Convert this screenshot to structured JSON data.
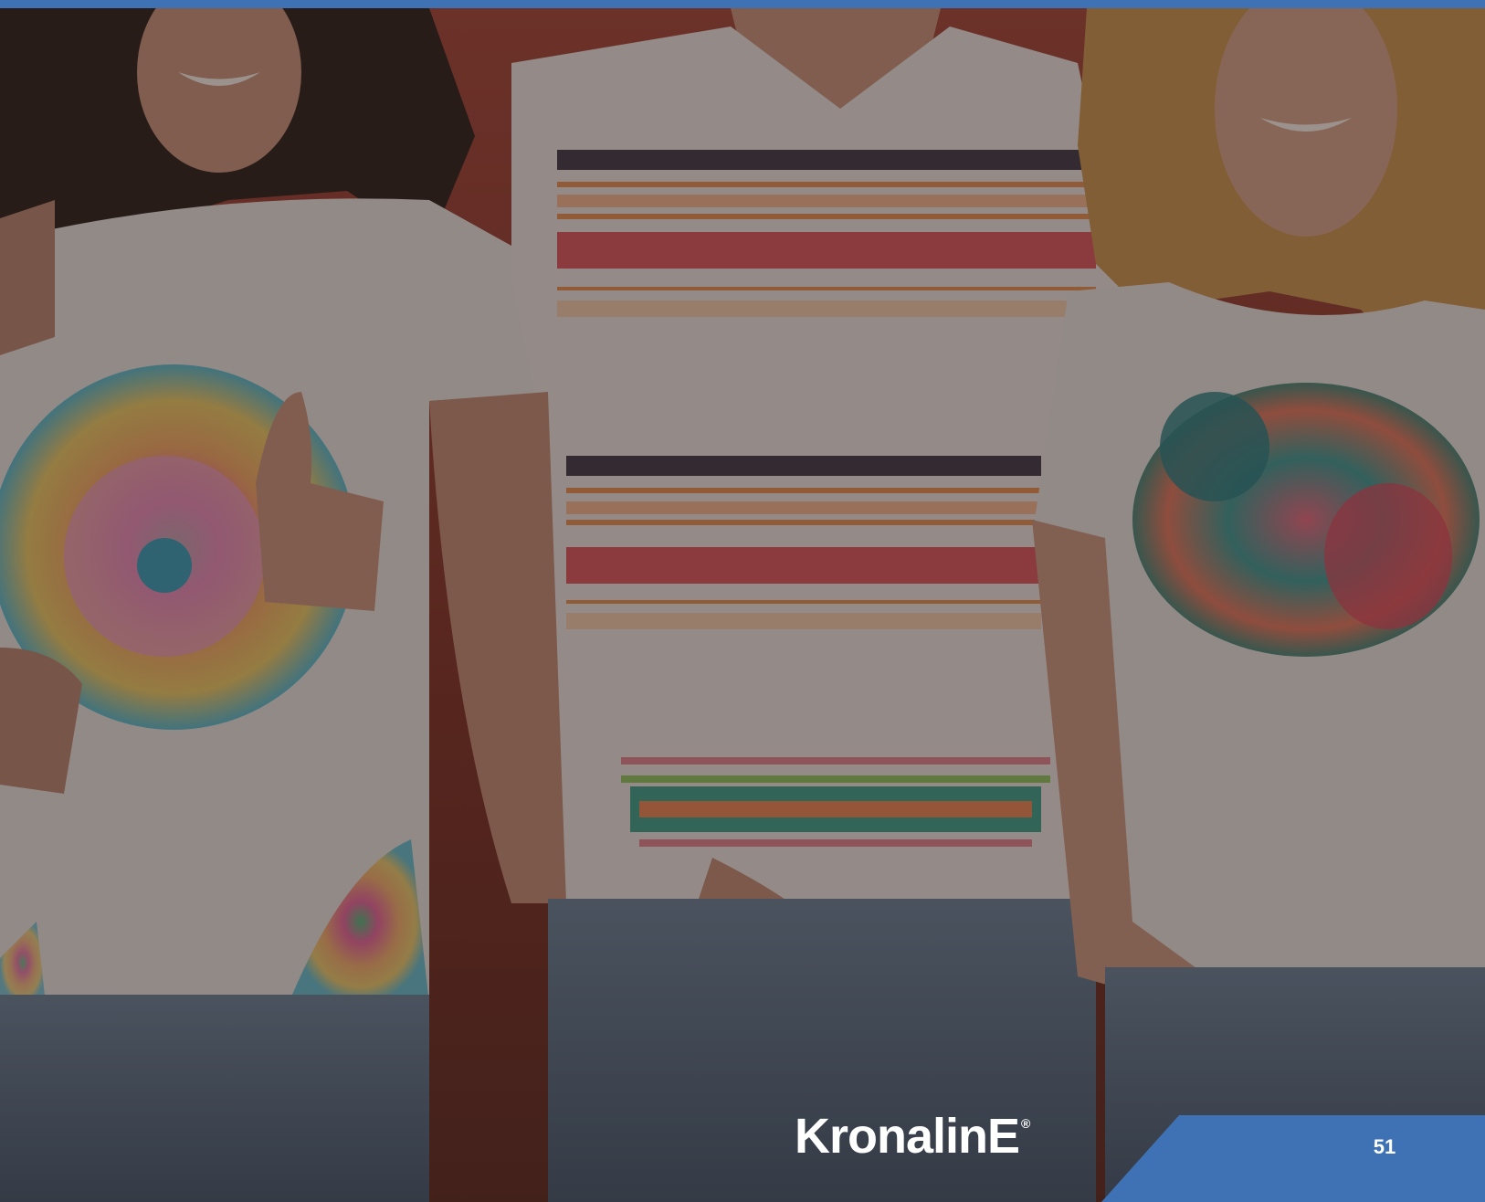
{
  "page": {
    "accent_color": "#3f72b5",
    "page_number": "51"
  },
  "brand": {
    "name": "KronalinE",
    "registered_mark": "®"
  },
  "photo": {
    "subject": "three-people-in-printed-white-t-shirts",
    "colors": {
      "wall": "#8a3b30",
      "shirt": "#e6dedb",
      "denim": "#5a6f86",
      "skin": "#c9927c",
      "hair_dark": "#2e211d",
      "hair_blonde": "#c8934e"
    }
  }
}
